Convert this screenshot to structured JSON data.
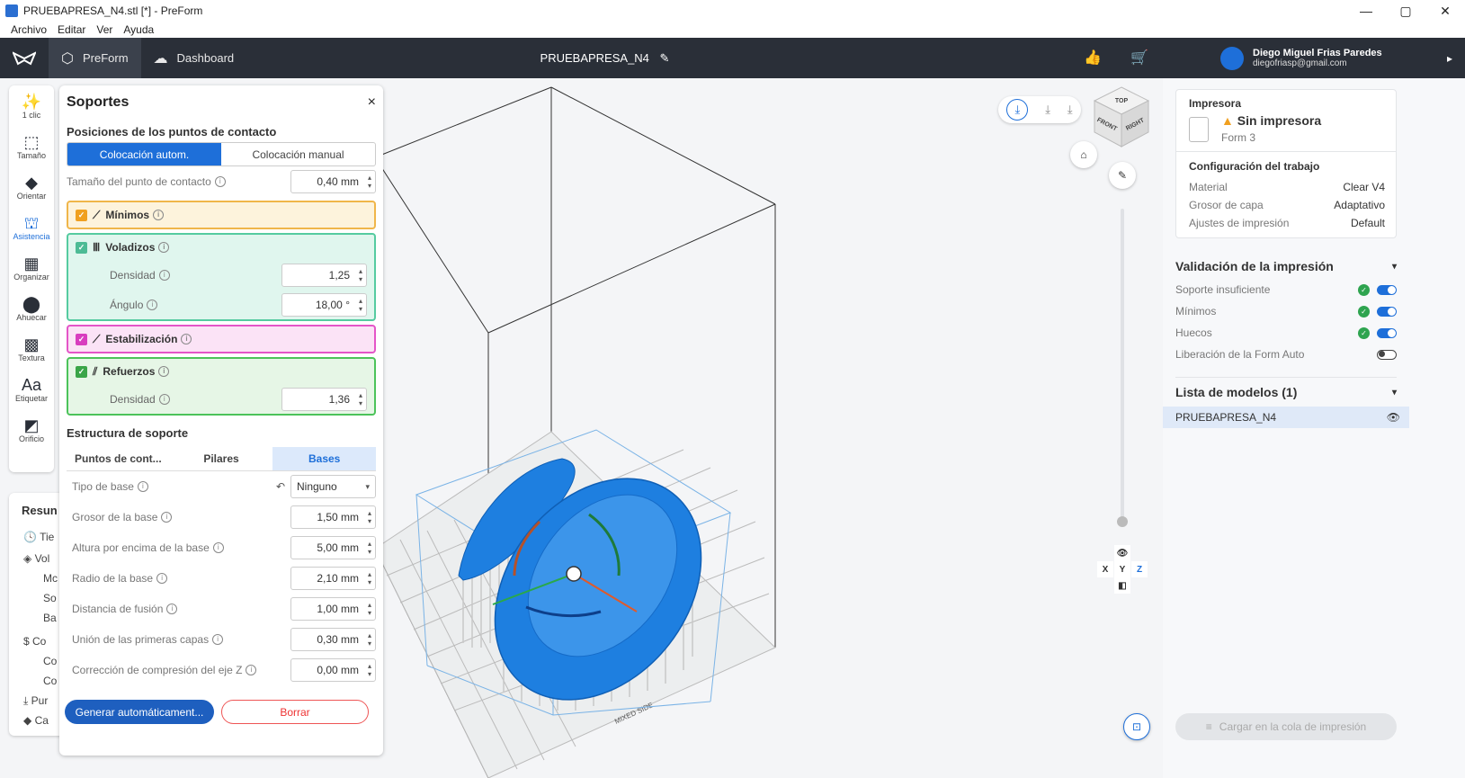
{
  "window": {
    "title": "PRUEBAPRESA_N4.stl [*] - PreForm",
    "minimize": "—",
    "maximize": "▢",
    "close": "✕"
  },
  "menu": [
    "Archivo",
    "Editar",
    "Ver",
    "Ayuda"
  ],
  "nav": {
    "tabs": [
      {
        "label": "PreForm",
        "icon": "preform-icon"
      },
      {
        "label": "Dashboard",
        "icon": "cloud-icon"
      }
    ],
    "project_title": "PRUEBAPRESA_N4"
  },
  "user": {
    "name": "Diego Miguel Frias Paredes",
    "email": "diegofriasp@gmail.com"
  },
  "left_tools": [
    {
      "label": "1 clic",
      "glyph": "✨"
    },
    {
      "label": "Tamaño",
      "glyph": "⬚"
    },
    {
      "label": "Orientar",
      "glyph": "◆"
    },
    {
      "label": "Asistencia",
      "glyph": "⛫"
    },
    {
      "label": "Organizar",
      "glyph": "▦"
    },
    {
      "label": "Ahuecar",
      "glyph": "⬤"
    },
    {
      "label": "Textura",
      "glyph": "▩"
    },
    {
      "label": "Etiquetar",
      "glyph": "Aa"
    },
    {
      "label": "Orificio",
      "glyph": "◩"
    }
  ],
  "supports": {
    "title": "Soportes",
    "close": "×",
    "touchpoints_title": "Posiciones de los puntos de contacto",
    "auto_label": "Colocación autom.",
    "manual_label": "Colocación manual",
    "touchpoint_size_label": "Tamaño del punto de contacto",
    "touchpoint_size_value": "0,40 mm",
    "minimos_label": "Mínimos",
    "voladizos_label": "Voladizos",
    "densidad_label": "Densidad",
    "voladizos_densidad": "1,25",
    "angulo_label": "Ángulo",
    "angulo_value": "18,00 °",
    "estabilizacion_label": "Estabilización",
    "refuerzos_label": "Refuerzos",
    "refuerzos_densidad": "1,36",
    "structure_title": "Estructura de soporte",
    "tabs": [
      "Puntos de cont...",
      "Pilares",
      "Bases"
    ],
    "tipo_base_label": "Tipo de base",
    "tipo_base_value": "Ninguno",
    "fields": [
      {
        "label": "Grosor de la base",
        "value": "1,50 mm"
      },
      {
        "label": "Altura por encima de la base",
        "value": "5,00 mm"
      },
      {
        "label": "Radio de la base",
        "value": "2,10 mm"
      },
      {
        "label": "Distancia de fusión",
        "value": "1,00 mm"
      },
      {
        "label": "Unión de las primeras capas",
        "value": "0,30 mm"
      },
      {
        "label": "Corrección de compresión del eje Z",
        "value": "0,00 mm"
      }
    ],
    "generate_label": "Generar automáticament...",
    "delete_label": "Borrar"
  },
  "resumen": {
    "title": "Resun",
    "lines": [
      "Tie",
      "Vol",
      "Mc",
      "So",
      "Ba",
      "Co",
      "Co",
      "Co",
      "Pur",
      "Ca"
    ]
  },
  "printer": {
    "section_label": "Impresora",
    "status": "Sin impresora",
    "model": "Form 3",
    "job_title": "Configuración del trabajo",
    "rows": [
      {
        "k": "Material",
        "v": "Clear V4"
      },
      {
        "k": "Grosor de capa",
        "v": "Adaptativo"
      },
      {
        "k": "Ajustes de impresión",
        "v": "Default"
      }
    ]
  },
  "validation": {
    "title": "Validación de la impresión",
    "rows": [
      {
        "label": "Soporte insuficiente",
        "ok": true,
        "on": true
      },
      {
        "label": "Mínimos",
        "ok": true,
        "on": true
      },
      {
        "label": "Huecos",
        "ok": true,
        "on": true
      },
      {
        "label": "Liberación de la Form Auto",
        "ok": false,
        "on": false
      }
    ]
  },
  "models": {
    "title": "Lista de modelos (1)",
    "items": [
      "PRUEBAPRESA_N4"
    ]
  },
  "queue_label": "Cargar en la cola de impresión",
  "cube": {
    "top": "TOP",
    "front": "FRONT",
    "right": "RIGHT"
  },
  "axes": {
    "x": "X",
    "y": "Y",
    "z": "Z"
  },
  "platform_label": "MIXED SIDE",
  "colors": {
    "accent": "#1e6fd9",
    "nav": "#2a2f38",
    "model": "#1e7fe0"
  }
}
